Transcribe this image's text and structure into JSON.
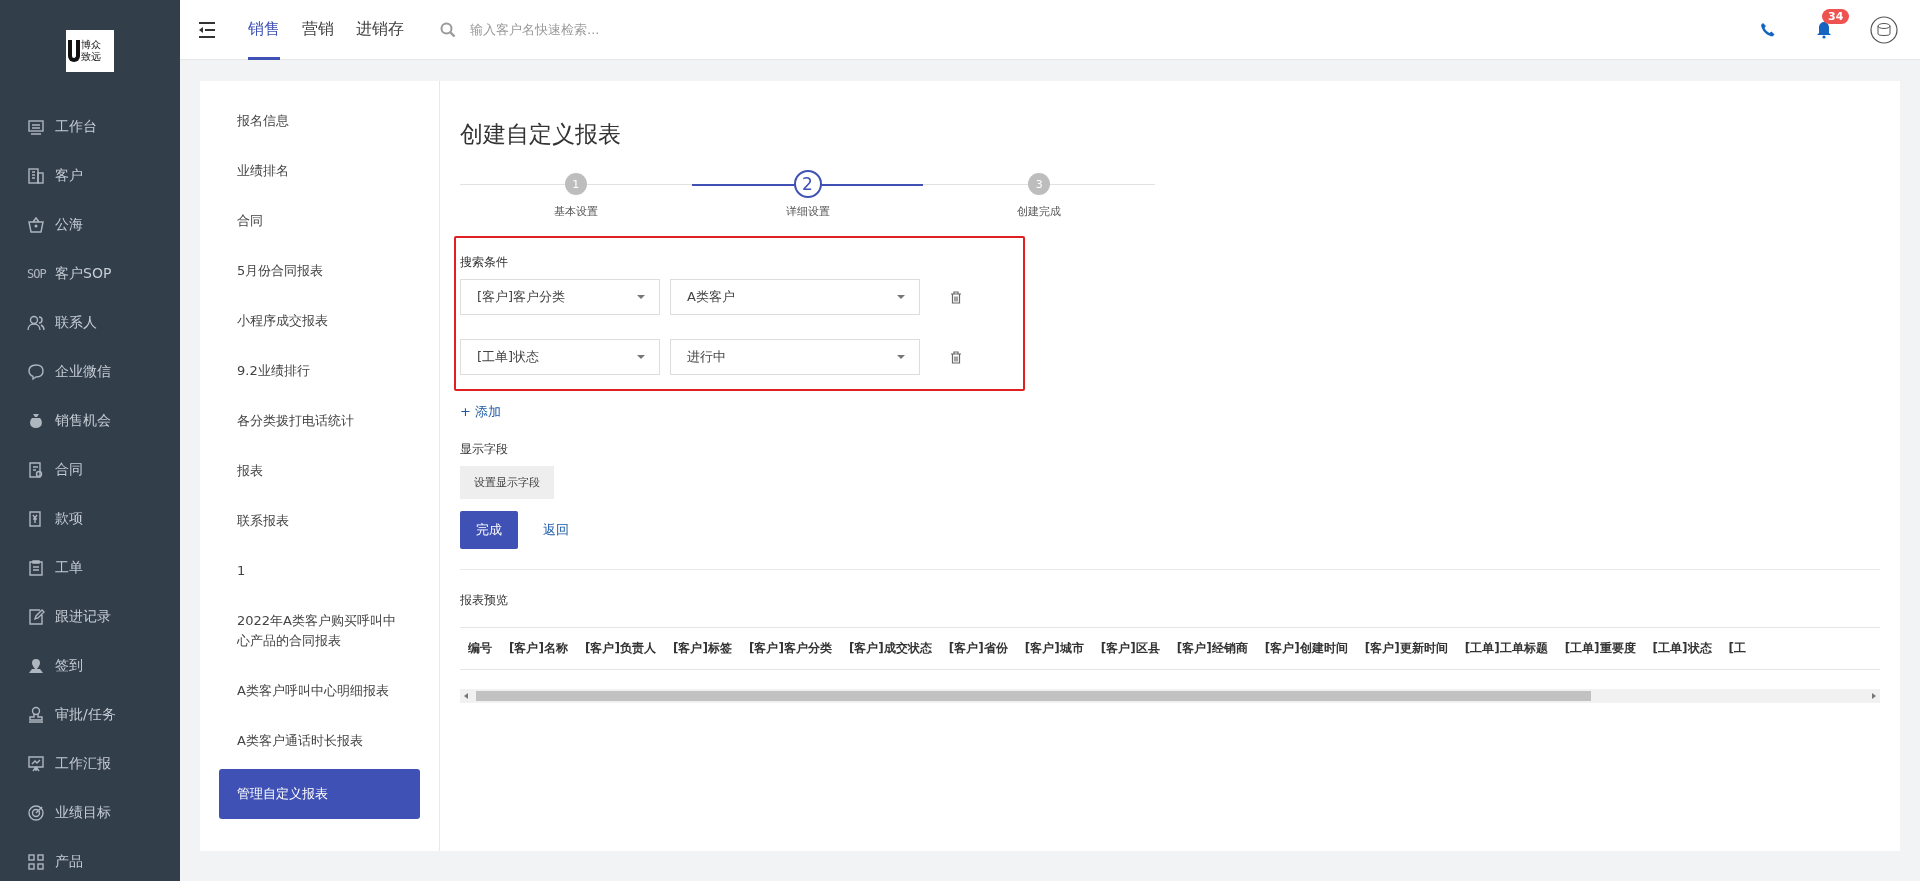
{
  "logo": {
    "line_1": "博众",
    "line_2": "致远"
  },
  "sidebar": {
    "items": [
      {
        "label": "工作台"
      },
      {
        "label": "客户"
      },
      {
        "label": "公海"
      },
      {
        "label": "客户SOP",
        "icon_text": "SOP"
      },
      {
        "label": "联系人"
      },
      {
        "label": "企业微信"
      },
      {
        "label": "销售机会"
      },
      {
        "label": "合同"
      },
      {
        "label": "款项"
      },
      {
        "label": "工单"
      },
      {
        "label": "跟进记录"
      },
      {
        "label": "签到"
      },
      {
        "label": "审批/任务"
      },
      {
        "label": "工作汇报"
      },
      {
        "label": "业绩目标"
      },
      {
        "label": "产品"
      }
    ]
  },
  "top_nav": {
    "tabs": [
      {
        "label": "销售",
        "selected": true
      },
      {
        "label": "营销",
        "selected": false
      },
      {
        "label": "进销存",
        "selected": false
      }
    ],
    "search": {
      "placeholder": "输入客户名快速检索..."
    },
    "notification_count": "34"
  },
  "report_list": {
    "items": [
      {
        "label": "报名信息",
        "selected": false
      },
      {
        "label": "业绩排名",
        "selected": false
      },
      {
        "label": "合同",
        "selected": false
      },
      {
        "label": "5月份合同报表",
        "selected": false
      },
      {
        "label": "小程序成交报表",
        "selected": false
      },
      {
        "label": "9.2业绩排行",
        "selected": false
      },
      {
        "label": "各分类拨打电话统计",
        "selected": false
      },
      {
        "label": "报表",
        "selected": false
      },
      {
        "label": "联系报表",
        "selected": false
      },
      {
        "label": "1",
        "selected": false
      },
      {
        "label": "2022年A类客户购买呼叫中心产品的合同报表",
        "selected": false
      },
      {
        "label": "A类客户呼叫中心明细报表",
        "selected": false
      },
      {
        "label": "A类客户通话时长报表",
        "selected": false
      },
      {
        "label": "管理自定义报表",
        "selected": true
      }
    ]
  },
  "page_title": "创建自定义报表",
  "steps": [
    {
      "number": "1",
      "label": "基本设置",
      "selected": false
    },
    {
      "number": "2",
      "label": "详细设置",
      "selected": true
    },
    {
      "number": "3",
      "label": "创建完成",
      "selected": false
    }
  ],
  "search_conditions": {
    "label": "搜索条件",
    "rows": [
      {
        "field": "[客户]客户分类",
        "value": "A类客户"
      },
      {
        "field": "[工单]状态",
        "value": "进行中"
      }
    ],
    "add_link": "+ 添加"
  },
  "display_fields": {
    "label": "显示字段",
    "button": "设置显示字段"
  },
  "buttons": {
    "finish": "完成",
    "back": "返回"
  },
  "preview": {
    "title": "报表预览",
    "columns": [
      "编号",
      "[客户]名称",
      "[客户]负责人",
      "[客户]标签",
      "[客户]客户分类",
      "[客户]成交状态",
      "[客户]省份",
      "[客户]城市",
      "[客户]区县",
      "[客户]经销商",
      "[客户]创建时间",
      "[客户]更新时间",
      "[工单]工单标题",
      "[工单]重要度",
      "[工单]状态",
      "[工"
    ]
  }
}
